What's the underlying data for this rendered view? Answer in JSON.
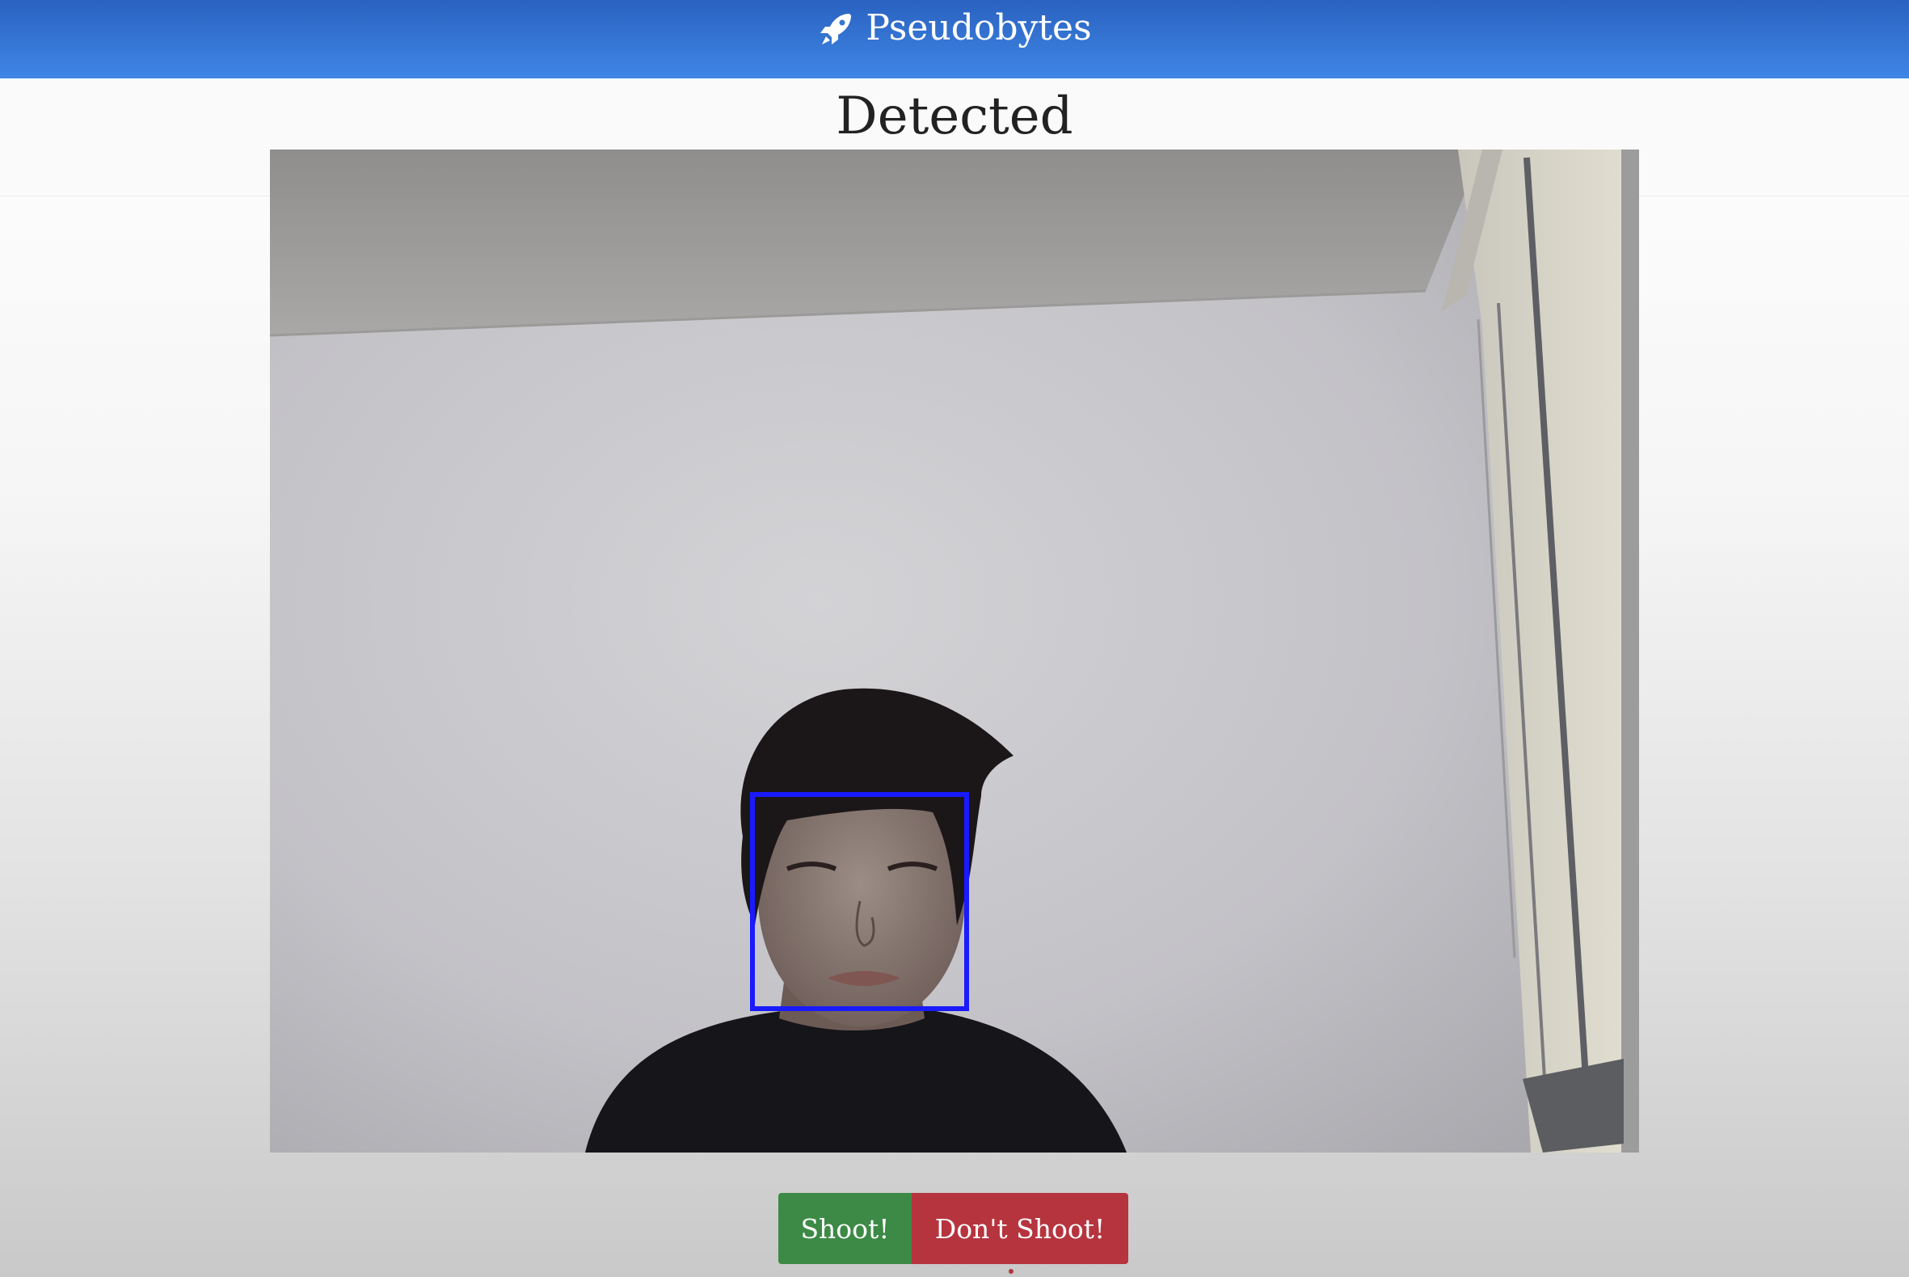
{
  "navbar": {
    "brand": "Pseudobytes",
    "brand_icon": "rocket-icon",
    "background": "#3476d6"
  },
  "page": {
    "title": "Detected"
  },
  "camera": {
    "content": "webcam-feed",
    "detection_box_color": "#1a1aff"
  },
  "actions": {
    "shoot_label": "Shoot!",
    "shoot_color": "#3c8a45",
    "dont_shoot_label": "Don't Shoot!",
    "dont_shoot_color": "#b6343e"
  }
}
